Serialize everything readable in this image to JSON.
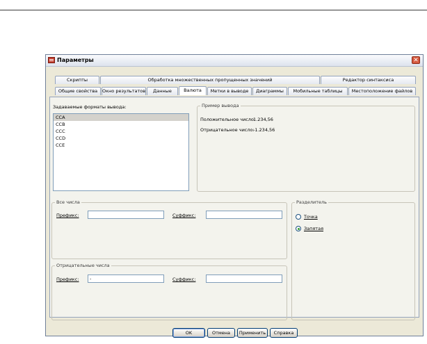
{
  "dialog": {
    "title": "Параметры"
  },
  "tabs_row1": [
    "Скрипты",
    "Обработка множественных пропущенных значений",
    "Редактор синтаксиса"
  ],
  "tabs_row2": [
    "Общие свойства",
    "Окно результатов",
    "Данные",
    "Валюта",
    "Метки в выводе",
    "Диаграммы",
    "Мобильные таблицы",
    "Местоположение файлов"
  ],
  "formats": {
    "label": "Задаваемые форматы вывода:",
    "items": [
      "CCA",
      "CCB",
      "CCC",
      "CCD",
      "CCE"
    ],
    "selected": "CCA"
  },
  "example": {
    "title": "Пример вывода",
    "positive_label": "Положительное число:",
    "positive_value": "1.234,56",
    "negative_label": "Отрицательное число:",
    "negative_value": "-1.234,56"
  },
  "all_numbers": {
    "title": "Все числа",
    "prefix_label": "Префикс:",
    "prefix_value": "",
    "suffix_label": "Суффикс:",
    "suffix_value": ""
  },
  "negative_numbers": {
    "title": "Отрицательные числа",
    "prefix_label": "Префикс:",
    "prefix_value": "-",
    "suffix_label": "Суффикс:",
    "suffix_value": ""
  },
  "separator": {
    "title": "Разделитель",
    "options": [
      "Точка",
      "Запятая"
    ],
    "selected": "Запятая"
  },
  "buttons": {
    "ok": "OK",
    "cancel": "Отмена",
    "apply": "Применить",
    "help": "Справка"
  }
}
